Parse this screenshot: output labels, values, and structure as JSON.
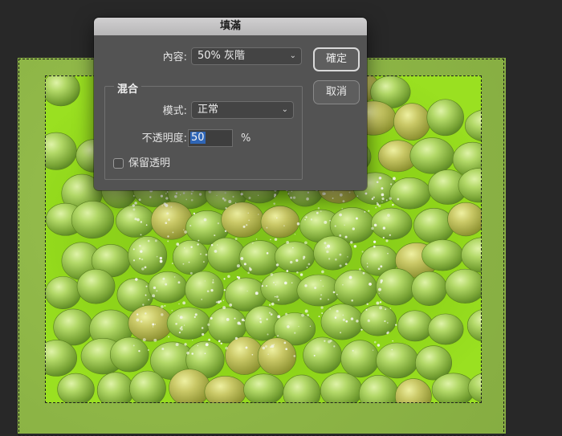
{
  "dialog": {
    "title": "填滿",
    "content_label": "內容:",
    "content_value": "50% 灰階",
    "ok_label": "確定",
    "cancel_label": "取消",
    "blending_group_title": "混合",
    "mode_label": "模式:",
    "mode_value": "正常",
    "opacity_label": "不透明度:",
    "opacity_value": "50",
    "opacity_unit": "%",
    "preserve_transparency_label": "保留透明",
    "preserve_transparency_checked": false
  },
  "icons": {
    "dropdown": "chevron-down-icon"
  },
  "colors": {
    "canvas_background": "#282828",
    "fill_overlay": "#8fb848",
    "photo_background": "#8fd51a",
    "dialog_background": "#535353",
    "selection_highlight": "#2f66b7"
  }
}
